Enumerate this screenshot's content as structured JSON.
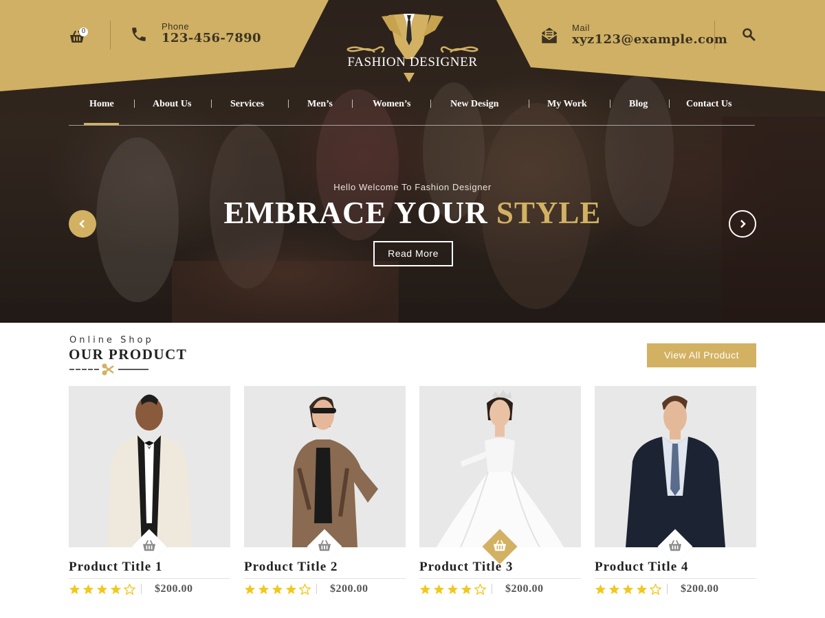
{
  "header": {
    "cart_count": "0",
    "phone_label": "Phone",
    "phone_value": "123-456-7890",
    "mail_label": "Mail",
    "mail_value": "xyz123@example.com",
    "logo_text": "FASHION DESIGNER"
  },
  "nav": {
    "items": [
      "Home",
      "About Us",
      "Services",
      "Men’s",
      "Women’s",
      "New Design",
      "My Work",
      "Blog",
      "Contact Us"
    ],
    "active": "Home"
  },
  "hero": {
    "subtitle": "Hello Welcome To Fashion Designer",
    "title_main": "EMBRACE YOUR ",
    "title_accent": "STYLE",
    "button_label": "Read More"
  },
  "products_section": {
    "eyebrow": "Online Shop",
    "title": "OUR PRODUCT",
    "view_all_label": "View All Product",
    "items": [
      {
        "title": "Product Title 1",
        "price": "$200.00",
        "rating": 4,
        "max_rating": 5
      },
      {
        "title": "Product Title 2",
        "price": "$200.00",
        "rating": 4,
        "max_rating": 5
      },
      {
        "title": "Product Title 3",
        "price": "$200.00",
        "rating": 4,
        "max_rating": 5
      },
      {
        "title": "Product Title 4",
        "price": "$200.00",
        "rating": 4,
        "max_rating": 5
      }
    ]
  },
  "icons": [
    "basket-icon",
    "phone-icon",
    "mail-icon",
    "search-icon",
    "chevron-left-icon",
    "chevron-right-icon",
    "scissors-icon",
    "star-icon"
  ],
  "colors": {
    "gold": "#d3b163",
    "dark_text": "#222222",
    "header_gold": "#d0b064",
    "star": "#f2c81f"
  }
}
